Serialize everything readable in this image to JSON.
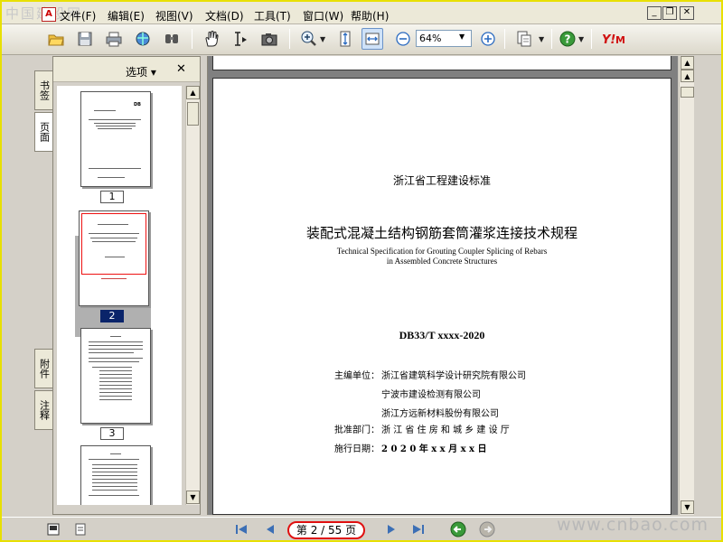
{
  "watermark_top": "中国建设网",
  "watermark_bottom": "www.cnbao.com",
  "menu": [
    "文件(F)",
    "编辑(E)",
    "视图(V)",
    "文档(D)",
    "工具(T)",
    "窗口(W)",
    "帮助(H)"
  ],
  "window_controls": [
    "_",
    "❐",
    "✕"
  ],
  "toolbar": {
    "zoom_value": "64%",
    "icons": [
      "open-icon",
      "save-icon",
      "print-icon",
      "email-icon",
      "search-icon",
      "hand-icon",
      "select-text-icon",
      "snapshot-icon",
      "zoom-in-icon",
      "fit-page-icon",
      "fit-width-icon",
      "zoom-out-icon",
      "zoom-plus-icon",
      "create-pdf-icon",
      "help-icon",
      "yahoo-icon"
    ]
  },
  "side_tabs": {
    "bookmarks": "书签",
    "pages": "页面",
    "attachments": "附件",
    "comments": "注释"
  },
  "sidebar": {
    "options_label": "选项 ▾",
    "close_label": "✕",
    "thumbnails": [
      "1",
      "2",
      "3"
    ],
    "thumb1_code": "DB",
    "selected_page": 2
  },
  "document": {
    "std_org": "浙江省工程建设标准",
    "title_cn": "装配式混凝土结构钢筋套筒灌浆连接技术规程",
    "title_en_1": "Technical Specification for Grouting Coupler Splicing of Rebars",
    "title_en_2": "in Assembled Concrete Structures",
    "code": "DB33/T xxxx-2020",
    "chief_label": "主编单位：",
    "chief_1": "浙江省建筑科学设计研究院有限公司",
    "chief_2": "宁波市建设检测有限公司",
    "chief_3": "浙江方远新材料股份有限公司",
    "approval_label": "批准部门：",
    "approval": "浙 江 省 住 房 和 城 乡 建 设 厅",
    "effective_label": "施行日期：",
    "effective": "2 0 2 0  年   x x  月   x x  日"
  },
  "status": {
    "page_indicator": "第 2 / 55 页"
  },
  "colors": {
    "accent": "#0a246a",
    "highlight_circle": "#e01010",
    "frame": "#e8e000"
  }
}
